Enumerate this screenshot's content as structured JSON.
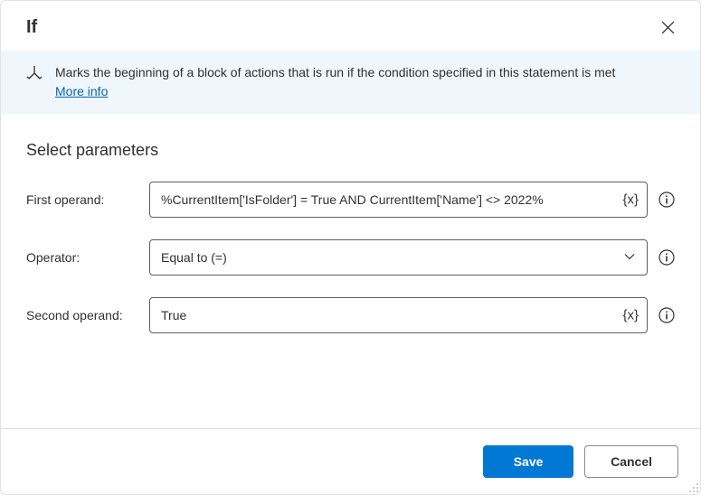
{
  "header": {
    "title": "If"
  },
  "banner": {
    "description": "Marks the beginning of a block of actions that is run if the condition specified in this statement is met",
    "more_info_label": "More info"
  },
  "section": {
    "title": "Select parameters"
  },
  "form": {
    "first_operand": {
      "label": "First operand:",
      "value": "%CurrentItem['IsFolder'] = True AND CurrentItem['Name'] <> 2022%"
    },
    "operator": {
      "label": "Operator:",
      "value": "Equal to (=)"
    },
    "second_operand": {
      "label": "Second operand:",
      "value": "True"
    }
  },
  "footer": {
    "save_label": "Save",
    "cancel_label": "Cancel"
  },
  "icons": {
    "variable_token": "{x}"
  }
}
